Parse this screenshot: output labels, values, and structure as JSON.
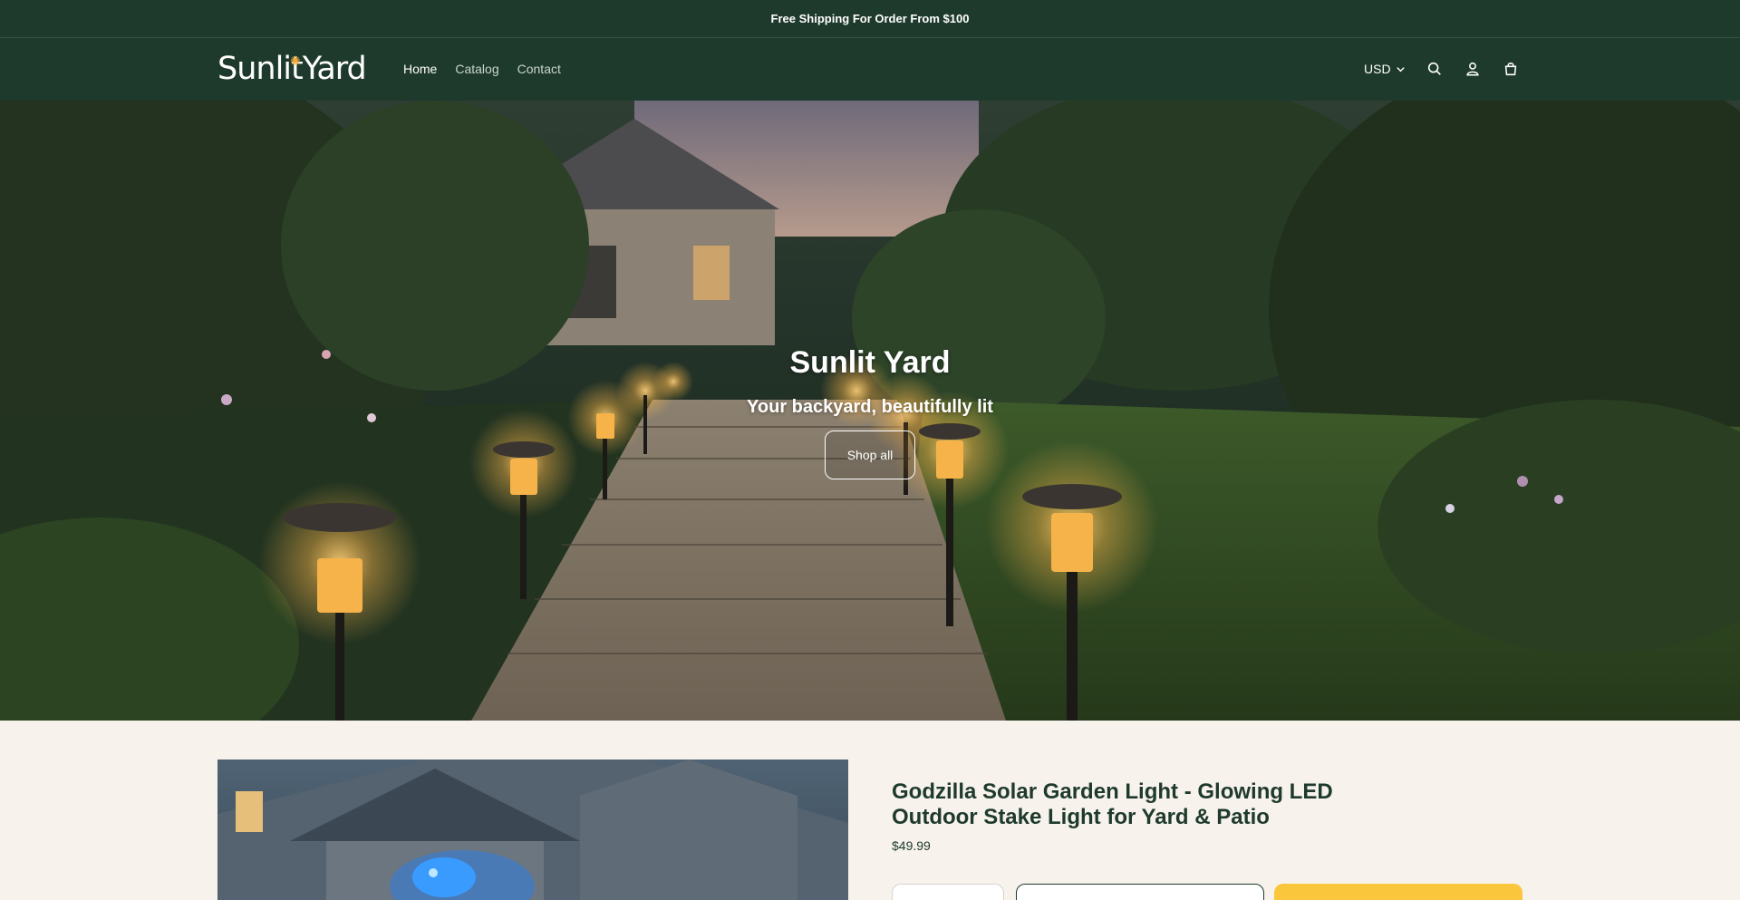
{
  "announcement": {
    "text": "Free Shipping For Order From $100"
  },
  "header": {
    "logo_text": "SunlitYard",
    "nav": [
      {
        "label": "Home",
        "active": true
      },
      {
        "label": "Catalog",
        "active": false
      },
      {
        "label": "Contact",
        "active": false
      }
    ],
    "currency": "USD",
    "icons": [
      "search-icon",
      "account-icon",
      "cart-icon"
    ]
  },
  "hero": {
    "title": "Sunlit Yard",
    "subtitle": "Your backyard, beautifully lit",
    "button_label": "Shop all"
  },
  "product": {
    "title": "Godzilla Solar Garden Light - Glowing LED Outdoor Stake Light for Yard & Patio",
    "price": "$49.99"
  },
  "colors": {
    "header_bg": "#1e3a2c",
    "page_bg": "#f7f2ec",
    "buy_button": "#f9c63c",
    "lamp_glow": "#f6b34a"
  }
}
